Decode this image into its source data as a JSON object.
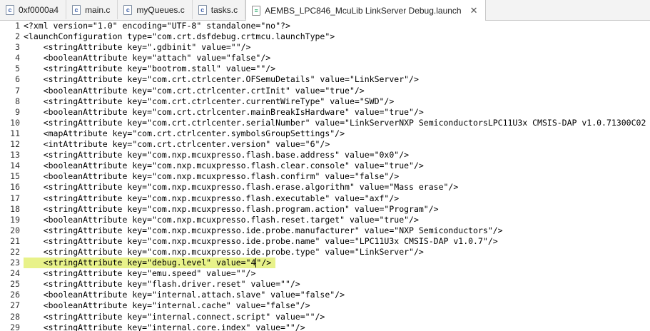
{
  "tabs": [
    {
      "icon": "c-file-icon",
      "glyph": "c",
      "label": "0xf0000a4"
    },
    {
      "icon": "c-file-icon",
      "glyph": "c",
      "label": "main.c"
    },
    {
      "icon": "c-file-icon",
      "glyph": "c",
      "label": "myQueues.c"
    },
    {
      "icon": "c-file-icon",
      "glyph": "c",
      "label": "tasks.c"
    },
    {
      "icon": "launch-file-icon",
      "glyph": "≡",
      "label": "AEMBS_LPC846_McuLib LinkServer Debug.launch",
      "close": "✕"
    }
  ],
  "editor": {
    "highlighted_line": 23,
    "lines": [
      {
        "n": "1",
        "text": "<?xml version=\"1.0\" encoding=\"UTF-8\" standalone=\"no\"?>"
      },
      {
        "n": "2",
        "text": "<launchConfiguration type=\"com.crt.dsfdebug.crtmcu.launchType\">"
      },
      {
        "n": "3",
        "text": "    <stringAttribute key=\".gdbinit\" value=\"\"/>"
      },
      {
        "n": "4",
        "text": "    <booleanAttribute key=\"attach\" value=\"false\"/>"
      },
      {
        "n": "5",
        "text": "    <stringAttribute key=\"bootrom.stall\" value=\"\"/>"
      },
      {
        "n": "6",
        "text": "    <stringAttribute key=\"com.crt.ctrlcenter.OFSemuDetails\" value=\"LinkServer\"/>"
      },
      {
        "n": "7",
        "text": "    <booleanAttribute key=\"com.crt.ctrlcenter.crtInit\" value=\"true\"/>"
      },
      {
        "n": "8",
        "text": "    <stringAttribute key=\"com.crt.ctrlcenter.currentWireType\" value=\"SWD\"/>"
      },
      {
        "n": "9",
        "text": "    <booleanAttribute key=\"com.crt.ctrlcenter.mainBreakIsHardware\" value=\"true\"/>"
      },
      {
        "n": "10",
        "text": "    <stringAttribute key=\"com.crt.ctrlcenter.serialNumber\" value=\"LinkServerNXP SemiconductorsLPC11U3x CMSIS-DAP v1.0.71300C02"
      },
      {
        "n": "11",
        "text": "    <mapAttribute key=\"com.crt.ctrlcenter.symbolsGroupSettings\"/>"
      },
      {
        "n": "12",
        "text": "    <intAttribute key=\"com.crt.ctrlcenter.version\" value=\"6\"/>"
      },
      {
        "n": "13",
        "text": "    <stringAttribute key=\"com.nxp.mcuxpresso.flash.base.address\" value=\"0x0\"/>"
      },
      {
        "n": "14",
        "text": "    <booleanAttribute key=\"com.nxp.mcuxpresso.flash.clear.console\" value=\"true\"/>"
      },
      {
        "n": "15",
        "text": "    <booleanAttribute key=\"com.nxp.mcuxpresso.flash.confirm\" value=\"false\"/>"
      },
      {
        "n": "16",
        "text": "    <stringAttribute key=\"com.nxp.mcuxpresso.flash.erase.algorithm\" value=\"Mass erase\"/>"
      },
      {
        "n": "17",
        "text": "    <stringAttribute key=\"com.nxp.mcuxpresso.flash.executable\" value=\"axf\"/>"
      },
      {
        "n": "18",
        "text": "    <stringAttribute key=\"com.nxp.mcuxpresso.flash.program.action\" value=\"Program\"/>"
      },
      {
        "n": "19",
        "text": "    <booleanAttribute key=\"com.nxp.mcuxpresso.flash.reset.target\" value=\"true\"/>"
      },
      {
        "n": "20",
        "text": "    <stringAttribute key=\"com.nxp.mcuxpresso.ide.probe.manufacturer\" value=\"NXP Semiconductors\"/>"
      },
      {
        "n": "21",
        "text": "    <stringAttribute key=\"com.nxp.mcuxpresso.ide.probe.name\" value=\"LPC11U3x CMSIS-DAP v1.0.7\"/>"
      },
      {
        "n": "22",
        "text": "    <stringAttribute key=\"com.nxp.mcuxpresso.ide.probe.type\" value=\"LinkServer\"/>"
      },
      {
        "n": "23",
        "before_caret": "    <stringAttribute key=\"debug.level\" value=\"4",
        "after_caret": "\"/>"
      },
      {
        "n": "24",
        "text": "    <stringAttribute key=\"emu.speed\" value=\"\"/>"
      },
      {
        "n": "25",
        "text": "    <stringAttribute key=\"flash.driver.reset\" value=\"\"/>"
      },
      {
        "n": "26",
        "text": "    <booleanAttribute key=\"internal.attach.slave\" value=\"false\"/>"
      },
      {
        "n": "27",
        "text": "    <booleanAttribute key=\"internal.cache\" value=\"false\"/>"
      },
      {
        "n": "28",
        "text": "    <stringAttribute key=\"internal.connect.script\" value=\"\"/>"
      },
      {
        "n": "29",
        "text": "    <stringAttribute key=\"internal.core.index\" value=\"\"/>"
      }
    ]
  }
}
